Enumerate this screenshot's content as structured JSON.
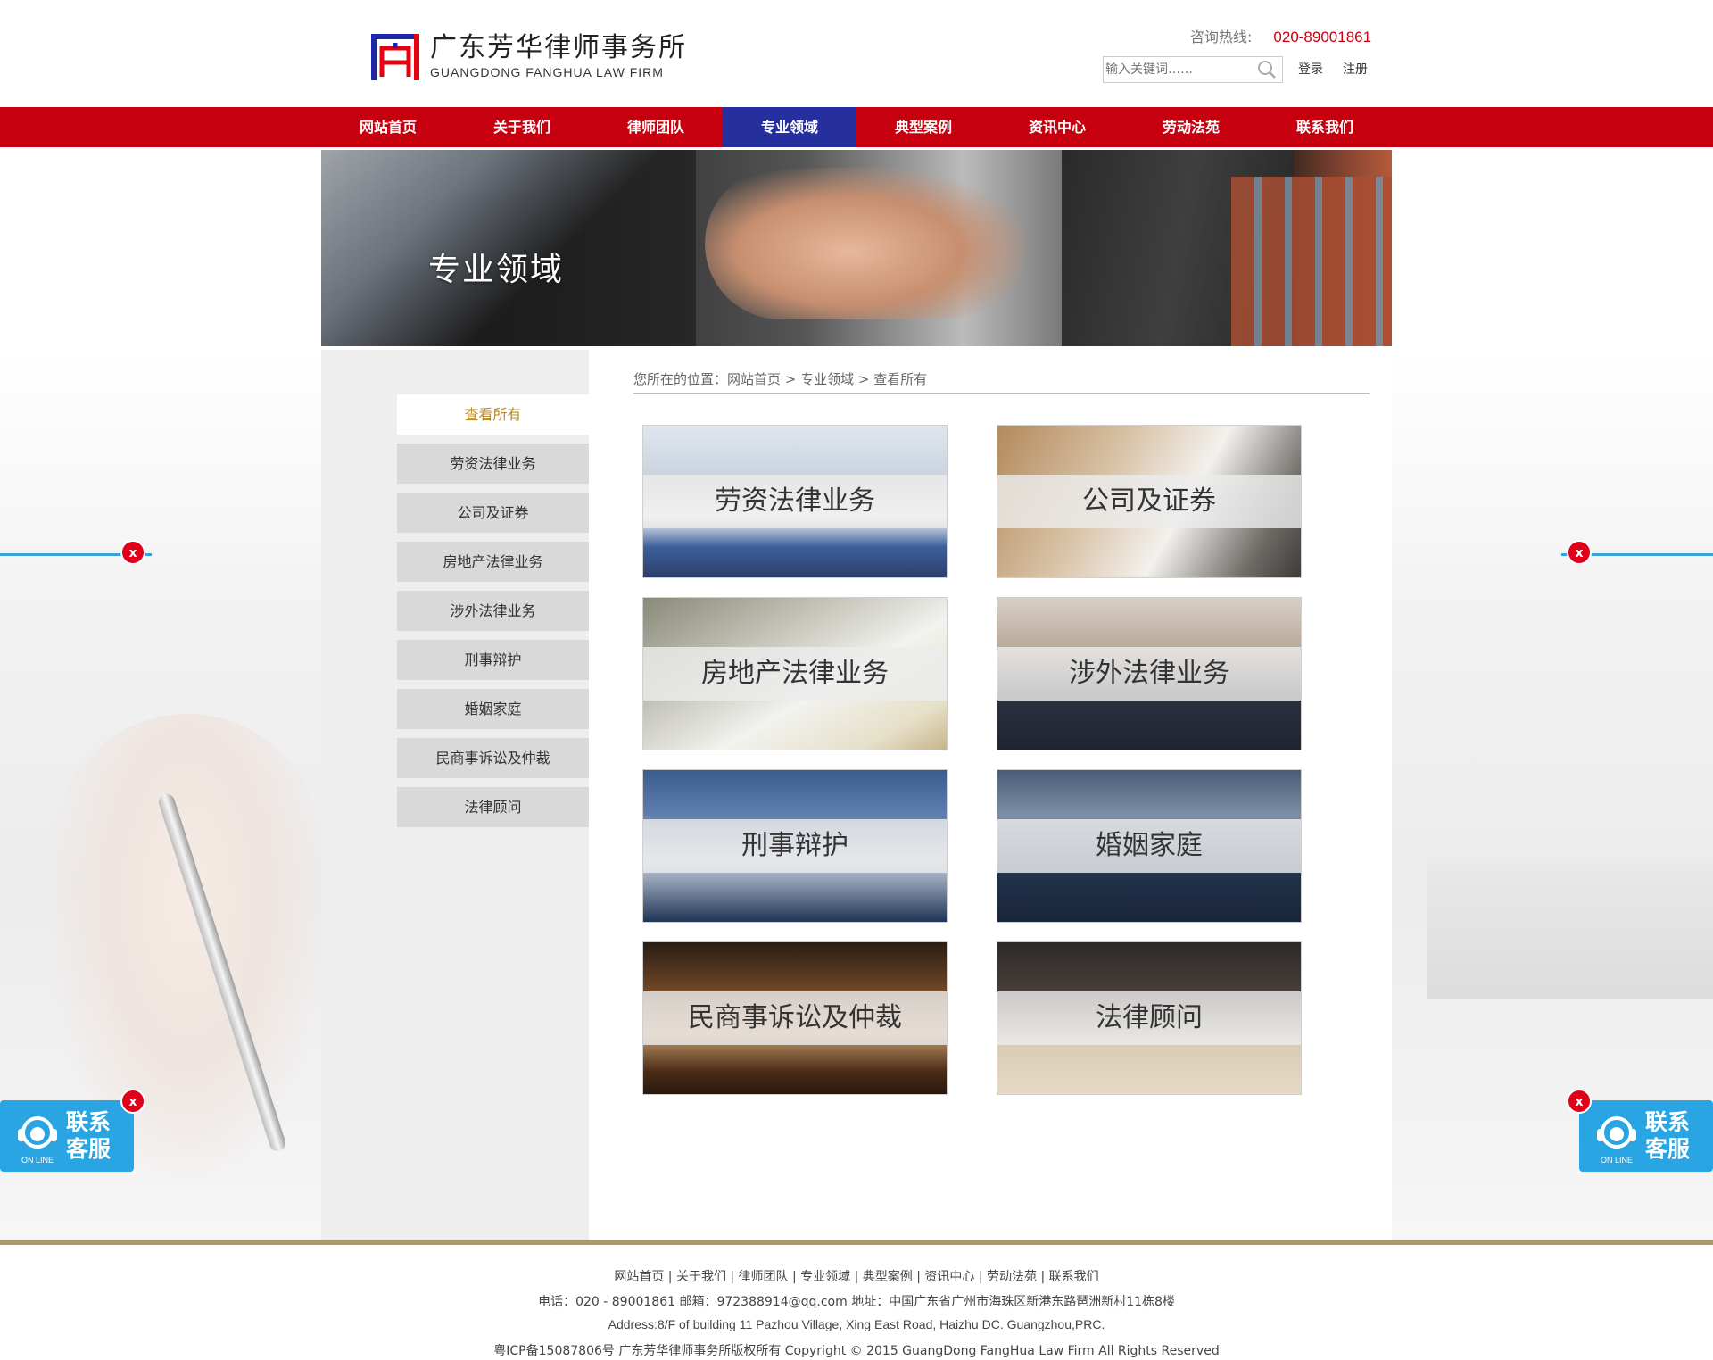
{
  "header": {
    "logo_cn": "广东芳华律师事务所",
    "logo_en": "GUANGDONG FANGHUA LAW  FIRM",
    "hotline_label": "咨询热线:",
    "hotline_number": "020-89001861",
    "search_placeholder": "输入关键词……",
    "login": "登录",
    "register": "注册"
  },
  "nav": {
    "items": [
      {
        "label": "网站首页"
      },
      {
        "label": "关于我们"
      },
      {
        "label": "律师团队"
      },
      {
        "label": "专业领域"
      },
      {
        "label": "典型案例"
      },
      {
        "label": "资讯中心"
      },
      {
        "label": "劳动法苑"
      },
      {
        "label": "联系我们"
      }
    ],
    "active_index": 3
  },
  "banner": {
    "title": "专业领域"
  },
  "breadcrumb": "您所在的位置：网站首页 > 专业领域 > 查看所有",
  "sidebar": {
    "items": [
      {
        "label": "查看所有"
      },
      {
        "label": "劳资法律业务"
      },
      {
        "label": "公司及证券"
      },
      {
        "label": "房地产法律业务"
      },
      {
        "label": "涉外法律业务"
      },
      {
        "label": "刑事辩护"
      },
      {
        "label": "婚姻家庭"
      },
      {
        "label": "民商事诉讼及仲裁"
      },
      {
        "label": "法律顾问"
      }
    ],
    "active_index": 0
  },
  "cards": [
    {
      "label": "劳资法律业务"
    },
    {
      "label": "公司及证券"
    },
    {
      "label": "房地产法律业务"
    },
    {
      "label": "涉外法律业务"
    },
    {
      "label": "刑事辩护"
    },
    {
      "label": "婚姻家庭"
    },
    {
      "label": "民商事诉讼及仲裁"
    },
    {
      "label": "法律顾问"
    }
  ],
  "float": {
    "close": "x",
    "kefu_text": "联系客服",
    "kefu_online": "ON LINE"
  },
  "footer": {
    "links": "网站首页 | 关于我们 | 律师团队 | 专业领域 | 典型案例 | 资讯中心 | 劳动法苑 | 联系我们",
    "contact": "电话：020 - 89001861    邮箱：972388914@qq.com     地址：中国广东省广州市海珠区新港东路琶洲新村11栋8楼",
    "address_en": "Address:8/F of building 11 Pazhou Village, Xing East Road, Haizhu DC. Guangzhou,PRC.",
    "copyright": "粤ICP备15087806号    广东芳华律师事务所版权所有 Copyright © 2015 GuangDong FangHua Law Firm All Rights Reserved"
  },
  "colors": {
    "nav_red": "#c6000e",
    "nav_active_blue": "#25309e",
    "hotline_red": "#c8000f",
    "kefu_blue": "#29a5e3",
    "close_red": "#e0001a",
    "footer_gold": "#a9996b"
  }
}
